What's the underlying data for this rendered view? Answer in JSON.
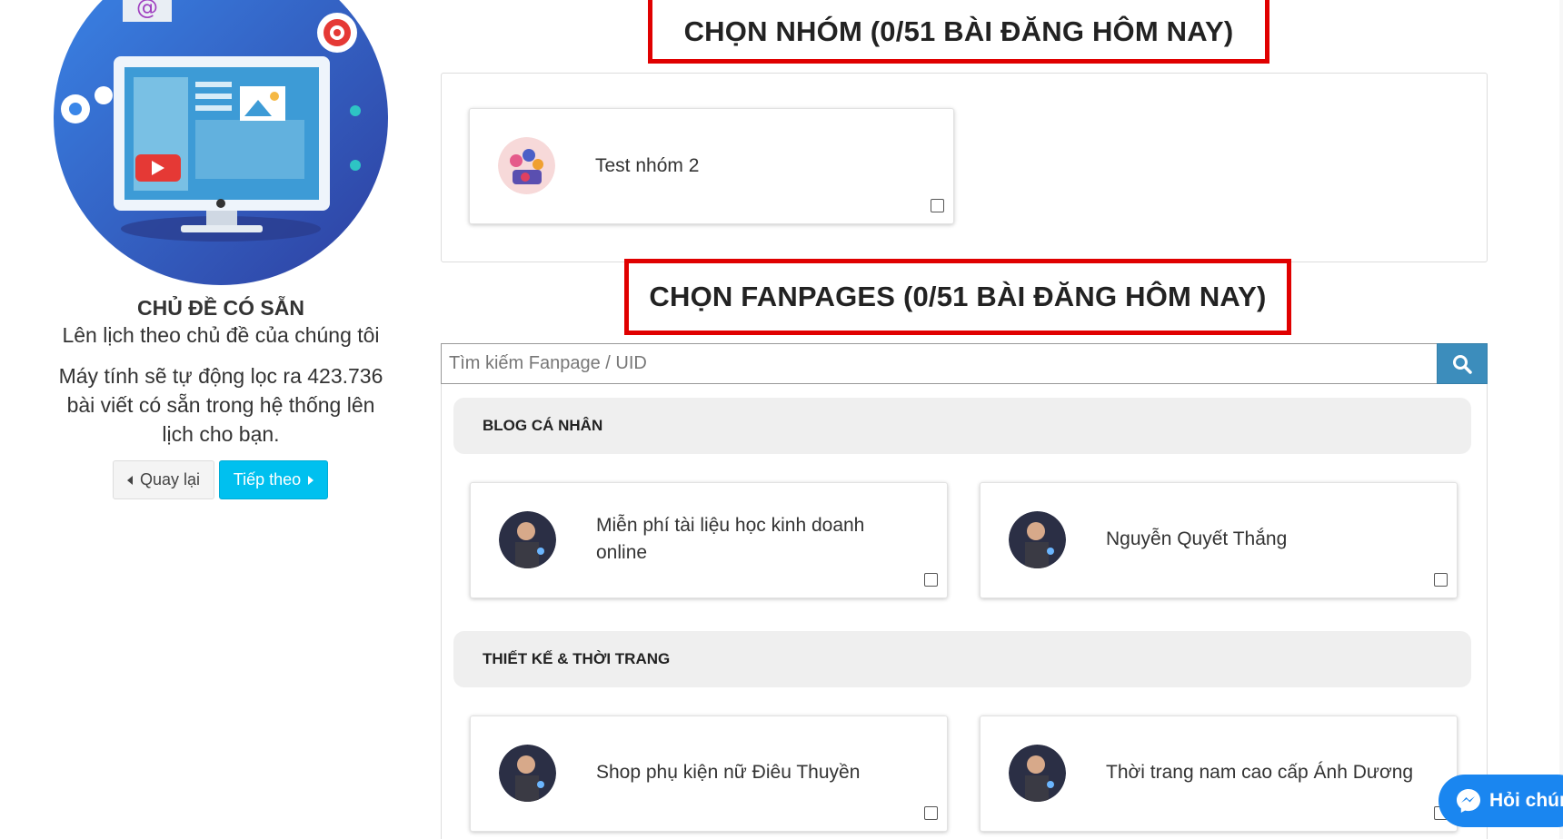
{
  "left": {
    "topic_title": "CHỦ ĐỀ CÓ SẴN",
    "topic_subtitle": "Lên lịch theo chủ đề của chúng tôi",
    "topic_description": "Máy tính sẽ tự động lọc ra 423.736 bài viết có sẵn trong hệ thống lên lịch cho bạn.",
    "back_label": "Quay lại",
    "next_label": "Tiếp theo"
  },
  "groups": {
    "heading": "CHỌN NHÓM (0/51 BÀI ĐĂNG HÔM NAY)",
    "items": [
      {
        "name": "Test nhóm 2",
        "checked": false
      }
    ]
  },
  "fanpages": {
    "heading": "CHỌN FANPAGES (0/51 BÀI ĐĂNG HÔM NAY)",
    "search_placeholder": "Tìm kiếm Fanpage / UID",
    "categories": [
      {
        "title": "BLOG CÁ NHÂN",
        "pages": [
          {
            "name": "Miễn phí tài liệu học kinh doanh online",
            "checked": false
          },
          {
            "name": "Nguyễn Quyết Thắng",
            "checked": false
          }
        ]
      },
      {
        "title": "THIẾT KẾ & THỜI TRANG",
        "pages": [
          {
            "name": "Shop phụ kiện nữ Điêu Thuyền",
            "checked": false
          },
          {
            "name": "Thời trang nam cao cấp Ánh Dương",
            "checked": false
          }
        ]
      }
    ]
  },
  "chat": {
    "label": "Hỏi chún"
  },
  "colors": {
    "heading_border": "#e00000",
    "next_button": "#00c0ef",
    "search_button": "#3c8dbc",
    "chat_button": "#1a86f0"
  },
  "icons": [
    "chevron-left-icon",
    "chevron-right-icon",
    "search-icon",
    "messenger-icon"
  ]
}
